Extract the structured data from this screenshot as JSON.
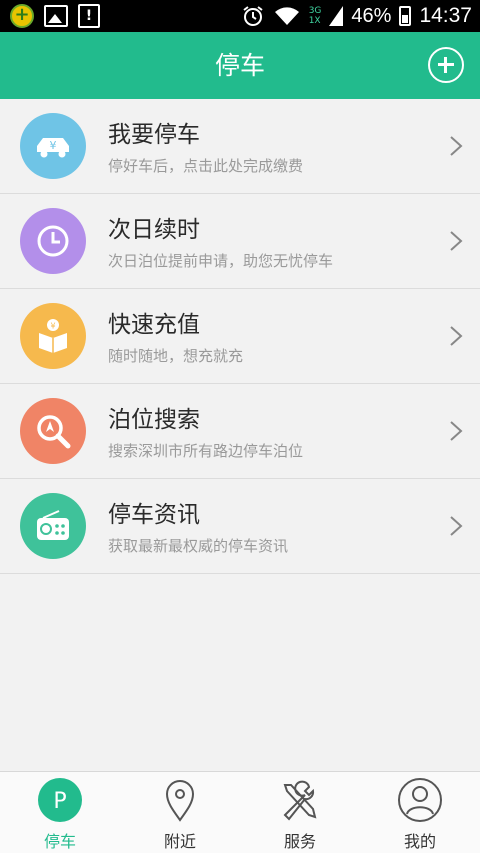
{
  "status_bar": {
    "network": "3G\n1X",
    "battery": "46%",
    "time": "14:37"
  },
  "header": {
    "title": "停车",
    "add_icon": "plus-circle-icon"
  },
  "menu": [
    {
      "title": "我要停车",
      "subtitle": "停好车后，点击此处完成缴费",
      "icon": "car-yuan-icon",
      "color": "#6fc4e6"
    },
    {
      "title": "次日续时",
      "subtitle": "次日泊位提前申请，助您无忧停车",
      "icon": "clock-icon",
      "color": "#b38fea"
    },
    {
      "title": "快速充值",
      "subtitle": "随时随地，想充就充",
      "icon": "coin-box-icon",
      "color": "#f6b94d"
    },
    {
      "title": "泊位搜索",
      "subtitle": "搜索深圳市所有路边停车泊位",
      "icon": "search-compass-icon",
      "color": "#f08466"
    },
    {
      "title": "停车资讯",
      "subtitle": "获取最新最权威的停车资讯",
      "icon": "radio-icon",
      "color": "#3fc29a"
    }
  ],
  "bottom_nav": [
    {
      "label": "停车",
      "icon": "parking-icon",
      "active": true
    },
    {
      "label": "附近",
      "icon": "location-pin-icon",
      "active": false
    },
    {
      "label": "服务",
      "icon": "tools-icon",
      "active": false
    },
    {
      "label": "我的",
      "icon": "user-icon",
      "active": false
    }
  ],
  "colors": {
    "accent": "#22bb8d",
    "background": "#f2f2f2"
  }
}
